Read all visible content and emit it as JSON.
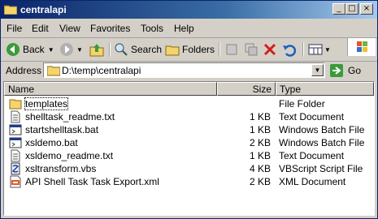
{
  "window": {
    "title": "centralapi",
    "minimize": "_",
    "maximize": "□",
    "close": "×"
  },
  "menu": [
    {
      "label": "File"
    },
    {
      "label": "Edit"
    },
    {
      "label": "View"
    },
    {
      "label": "Favorites"
    },
    {
      "label": "Tools"
    },
    {
      "label": "Help"
    }
  ],
  "toolbar": {
    "back_label": "Back",
    "search_label": "Search",
    "folders_label": "Folders"
  },
  "address": {
    "label": "Address",
    "value": "D:\\temp\\centralapi",
    "go_label": "Go"
  },
  "columns": {
    "name": "Name",
    "size": "Size",
    "type": "Type"
  },
  "files": [
    {
      "name": "templates",
      "size": "",
      "type": "File Folder",
      "icon": "folder-icon"
    },
    {
      "name": "shelltask_readme.txt",
      "size": "1 KB",
      "type": "Text Document",
      "icon": "text-file-icon"
    },
    {
      "name": "startshelltask.bat",
      "size": "1 KB",
      "type": "Windows Batch File",
      "icon": "batch-file-icon"
    },
    {
      "name": "xsldemo.bat",
      "size": "2 KB",
      "type": "Windows Batch File",
      "icon": "batch-file-icon"
    },
    {
      "name": "xsldemo_readme.txt",
      "size": "1 KB",
      "type": "Text Document",
      "icon": "text-file-icon"
    },
    {
      "name": "xsltransform.vbs",
      "size": "4 KB",
      "type": "VBScript Script File",
      "icon": "script-file-icon"
    },
    {
      "name": "API Shell Task Task Export.xml",
      "size": "2 KB",
      "type": "XML Document",
      "icon": "xml-file-icon"
    }
  ]
}
